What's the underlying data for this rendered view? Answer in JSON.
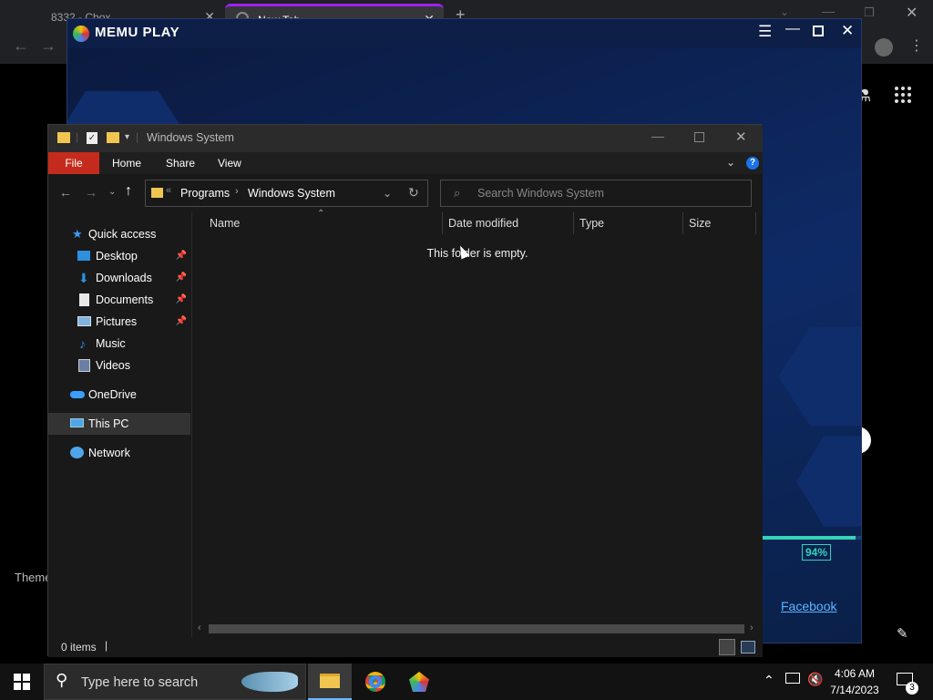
{
  "chrome": {
    "tabs": [
      {
        "label": "8332 - Cbox"
      },
      {
        "label": "New Tab"
      }
    ]
  },
  "left_fragment": {
    "text": "Theme"
  },
  "memu": {
    "logo_text": "MEMU PLAY",
    "progress_label": "94%",
    "progress_value": 0.94,
    "facebook_link": "Facebook"
  },
  "explorer": {
    "title": "Windows System",
    "ribbon": {
      "file": "File",
      "home": "Home",
      "share": "Share",
      "view": "View"
    },
    "address": {
      "crumbs": [
        "Programs",
        "Windows System"
      ]
    },
    "search": {
      "placeholder": "Search Windows System"
    },
    "nav": {
      "quick_access": "Quick access",
      "items": [
        {
          "label": "Desktop",
          "icon": "desktop-icon",
          "pinned": true
        },
        {
          "label": "Downloads",
          "icon": "downloads-icon",
          "pinned": true
        },
        {
          "label": "Documents",
          "icon": "documents-icon",
          "pinned": true
        },
        {
          "label": "Pictures",
          "icon": "pictures-icon",
          "pinned": true
        },
        {
          "label": "Music",
          "icon": "music-icon",
          "pinned": false
        },
        {
          "label": "Videos",
          "icon": "videos-icon",
          "pinned": false
        }
      ],
      "onedrive": "OneDrive",
      "this_pc": "This PC",
      "network": "Network"
    },
    "columns": {
      "name": "Name",
      "date_modified": "Date modified",
      "type": "Type",
      "size": "Size"
    },
    "empty_message": "This folder is empty.",
    "status": {
      "items": "0 items"
    }
  },
  "taskbar": {
    "search_placeholder": "Type here to search",
    "time": "4:06 AM",
    "date": "7/14/2023",
    "notification_count": "3"
  },
  "colors": {
    "accent_red": "#c42b1c",
    "memu_bg": "#0c2150",
    "progress": "#33d4b8",
    "link": "#5ab4ff"
  }
}
